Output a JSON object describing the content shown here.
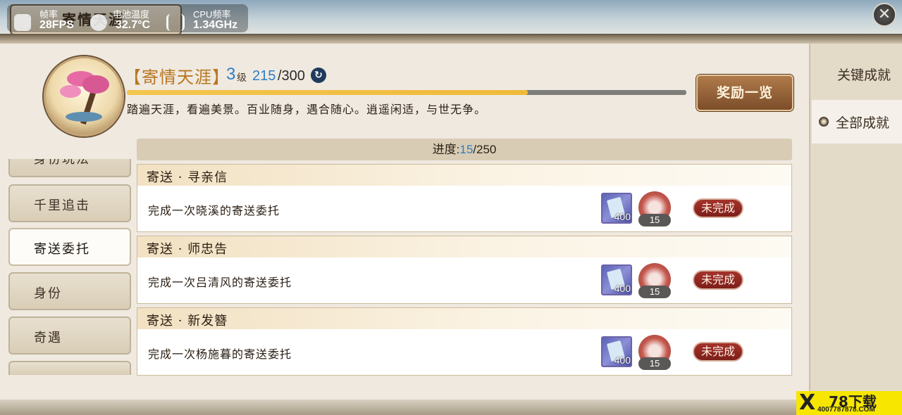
{
  "topbar": {
    "plaque_title": "寄情天涯",
    "overlay": {
      "fps_label": "帧率",
      "fps_value": "28FPS",
      "temp_label": "电池温度",
      "temp_value": "32.7°C",
      "cpu_label": "CPU频率",
      "cpu_value": "1.34GHz"
    },
    "close_symbol": "✕"
  },
  "header": {
    "title": "【寄情天涯】",
    "level": "3",
    "level_suffix": "级",
    "xp_current": "215",
    "xp_rest": "/300",
    "refresh_symbol": "↻",
    "xp_fraction": 0.717,
    "description": "踏遍天涯，看遍美景。百业随身，遇合随心。逍遥闲适，与世无争。",
    "reward_button": "奖励一览"
  },
  "right_tabs": [
    {
      "label": "关键成就",
      "active": false
    },
    {
      "label": "全部成就",
      "active": true
    }
  ],
  "left_menu": [
    {
      "label": "身份玩法",
      "active": false
    },
    {
      "label": "千里追击",
      "active": false
    },
    {
      "label": "寄送委托",
      "active": true
    },
    {
      "label": "身份",
      "active": false
    },
    {
      "label": "奇遇",
      "active": false
    },
    {
      "label": "",
      "active": false
    }
  ],
  "progress": {
    "label": "进度:",
    "current": "15",
    "total": "/250"
  },
  "tasks": [
    {
      "title": "寄送 · 寻亲信",
      "desc": "完成一次晓溪的寄送委托",
      "item_qty": "400",
      "coin_qty": "15",
      "status": "未完成"
    },
    {
      "title": "寄送 · 师忠告",
      "desc": "完成一次吕清风的寄送委托",
      "item_qty": "400",
      "coin_qty": "15",
      "status": "未完成"
    },
    {
      "title": "寄送 · 新发簪",
      "desc": "完成一次杨施暮的寄送委托",
      "item_qty": "400",
      "coin_qty": "15",
      "status": "未完成"
    }
  ],
  "watermark": {
    "brand": "78下载",
    "sub": "4007787878.COM"
  },
  "colors": {
    "accent_blue": "#2c7fc7",
    "title_gold": "#b8761f",
    "status_red": "#8f2a22"
  }
}
